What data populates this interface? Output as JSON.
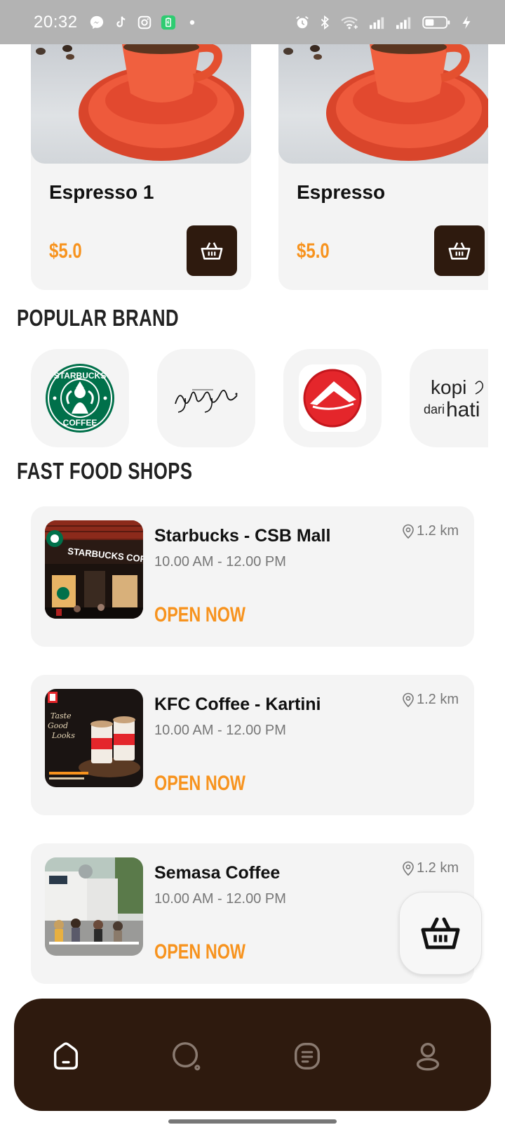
{
  "status_bar": {
    "time": "20:32",
    "left_icons": [
      "messenger-icon",
      "tiktok-icon",
      "instagram-icon",
      "battery-app-icon",
      "dot-icon"
    ],
    "right_icons": [
      "alarm-icon",
      "bluetooth-icon",
      "wifi-icon",
      "signal-icon",
      "signal-icon",
      "battery-icon",
      "charging-icon"
    ]
  },
  "products": [
    {
      "name": "Espresso 1",
      "price": "$5.0"
    },
    {
      "name": "Espresso",
      "price": "$5.0"
    }
  ],
  "popular_brand": {
    "title": "POPULAR BRAND",
    "brands": [
      {
        "name": "Starbucks",
        "logo_text": "STARBUCKS COFFEE"
      },
      {
        "name": "Janji Jiwa",
        "logo_text": "Janji Jiwa"
      },
      {
        "name": "Pizza Hut",
        "logo_text": ""
      },
      {
        "name": "Kopi dari Hati",
        "logo_text": "kopi dari hati"
      }
    ]
  },
  "fast_food_shops": {
    "title": "FAST FOOD SHOPS",
    "shops": [
      {
        "name": "Starbucks - CSB Mall",
        "hours": "10.00 AM - 12.00 PM",
        "distance": "1.2 km",
        "status": "OPEN NOW"
      },
      {
        "name": "KFC Coffee - Kartini",
        "hours": "10.00 AM - 12.00 PM",
        "distance": "1.2 km",
        "status": "OPEN NOW"
      },
      {
        "name": "Semasa Coffee",
        "hours": "10.00 AM - 12.00 PM",
        "distance": "1.2 km",
        "status": "OPEN NOW"
      }
    ]
  },
  "bottom_nav": {
    "items": [
      "home-icon",
      "search-icon",
      "orders-icon",
      "profile-icon"
    ],
    "active": "home-icon"
  },
  "colors": {
    "accent": "#f7931e",
    "dark_brown": "#2e1a0e",
    "card_bg": "#f4f4f4",
    "status_bar": "#b3b3b3"
  }
}
